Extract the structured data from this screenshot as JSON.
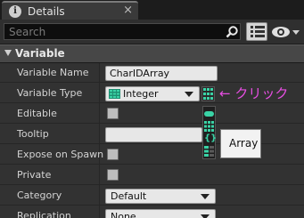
{
  "tab": {
    "icon": "info-icon",
    "icon_glyph": "i",
    "title": "Details",
    "close_glyph": "×"
  },
  "toolbar": {
    "search_placeholder": "Search",
    "search_icon": "search-icon",
    "view_icon": "grid-view-icon",
    "eye_icon": "eye-icon"
  },
  "section": {
    "title": "Variable",
    "arrow_icon": "collapse-arrow-icon"
  },
  "rows": {
    "variable_name": {
      "label": "Variable Name",
      "value": "CharIDArray"
    },
    "variable_type": {
      "label": "Variable Type",
      "value": "Integer",
      "type_icon": "array-grid-icon"
    },
    "editable": {
      "label": "Editable"
    },
    "tooltip": {
      "label": "Tooltip",
      "value": ""
    },
    "expose_on_spawn": {
      "label": "Expose on Spawn"
    },
    "private": {
      "label": "Private"
    },
    "category": {
      "label": "Category",
      "value": "Default"
    },
    "replication": {
      "label": "Replication",
      "value": "None"
    }
  },
  "container_popup": {
    "items": [
      "single-icon",
      "array-icon",
      "set-icon",
      "map-icon"
    ],
    "set_glyph": "{}"
  },
  "annotation": {
    "text": "← クリック"
  },
  "tooltip_popup": {
    "text": "Array"
  },
  "colors": {
    "integer_type": "#3ad3a6",
    "annotation": "#e54ee0"
  }
}
